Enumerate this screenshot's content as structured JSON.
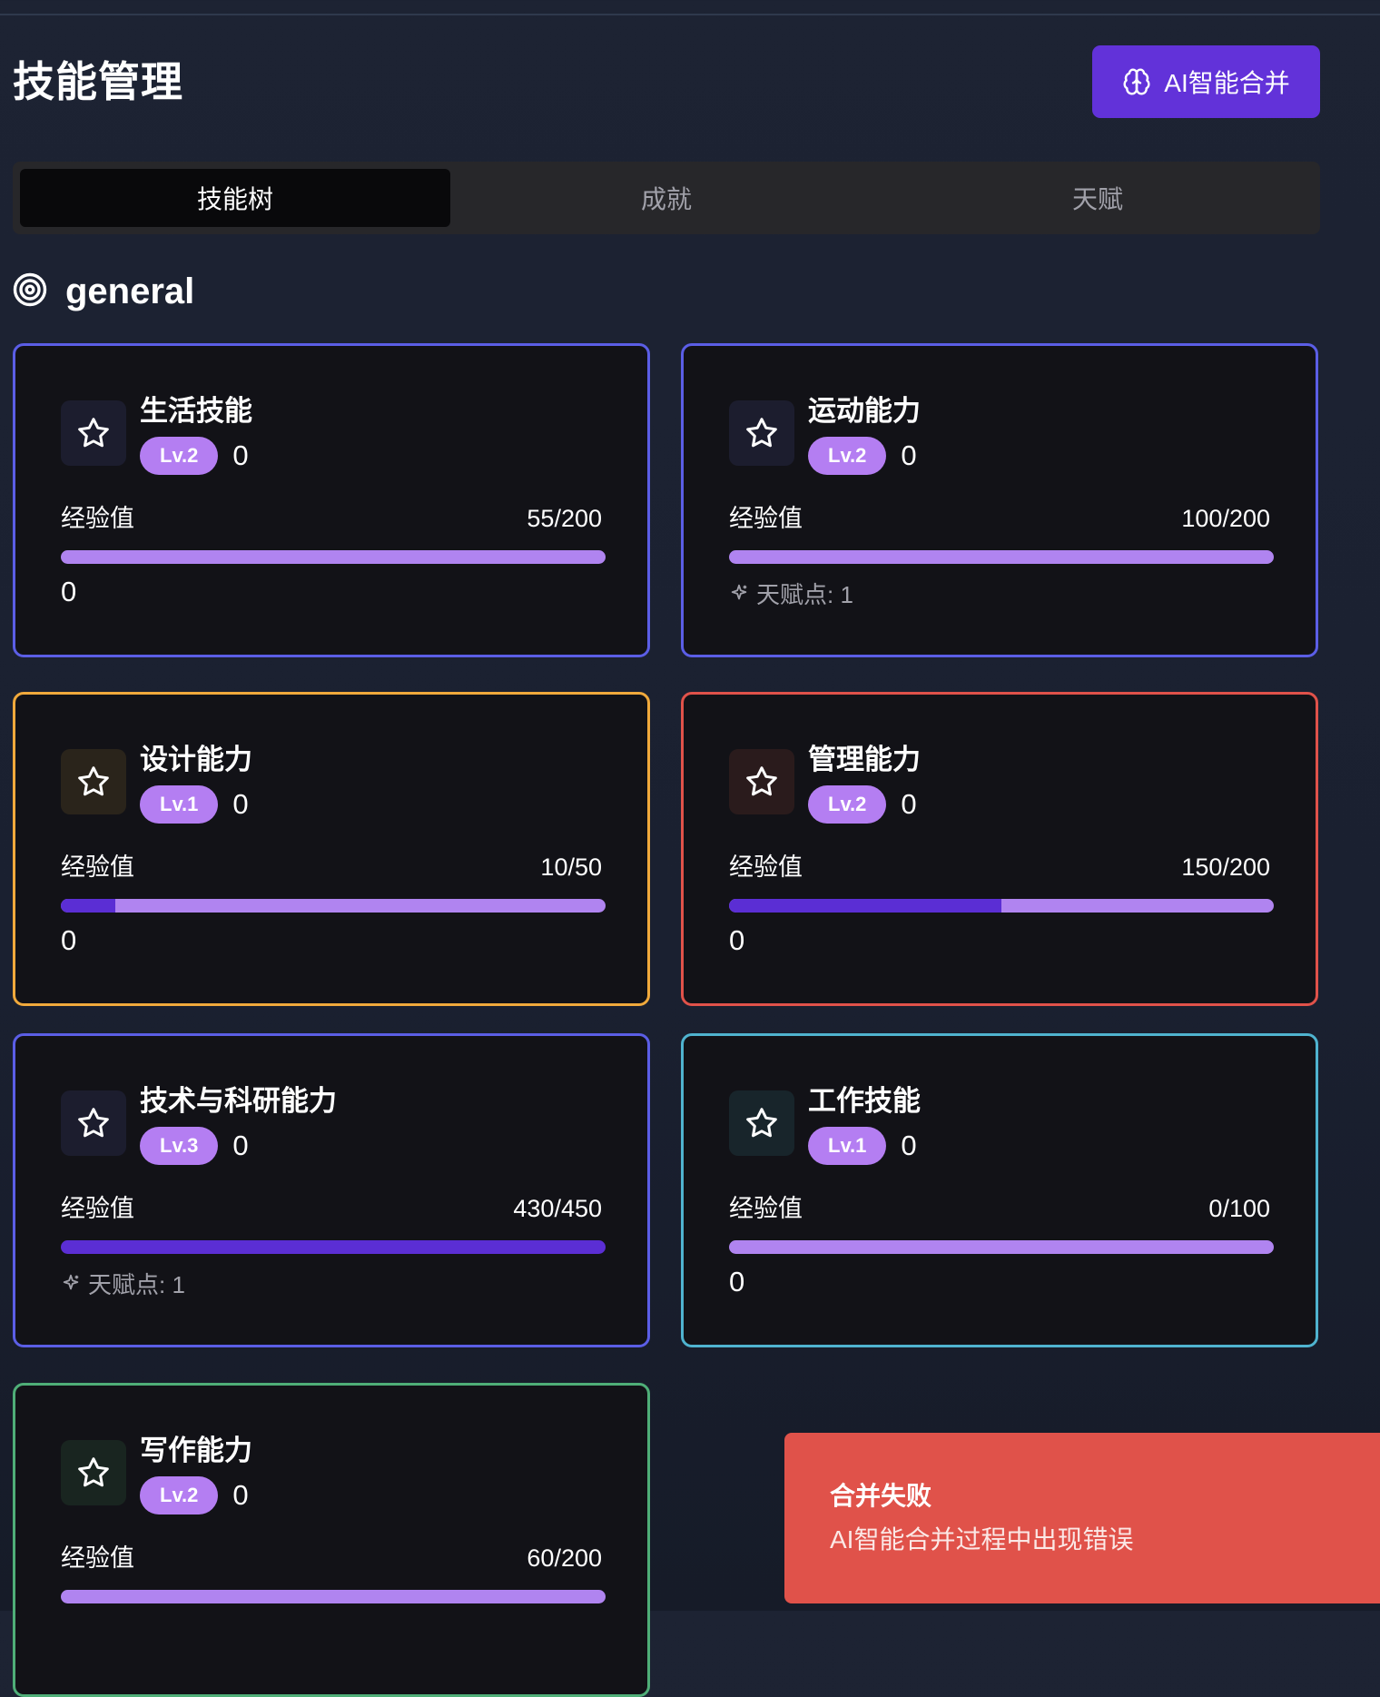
{
  "header": {
    "title": "技能管理",
    "ai_merge_label": "AI智能合并",
    "ai_merge_icon": "brain-icon"
  },
  "tabs": [
    {
      "label": "技能树",
      "active": true
    },
    {
      "label": "成就",
      "active": false
    },
    {
      "label": "天赋",
      "active": false
    }
  ],
  "section": {
    "title": "general",
    "icon": "target-icon"
  },
  "xp_label": "经验值",
  "skills": [
    {
      "name": "生活技能",
      "level": "Lv.2",
      "extra": "0",
      "xp": "55/200",
      "progress": 0.0,
      "footer": "0",
      "talent": null,
      "border_color": "#5b5ee6",
      "icon_bg": "#1c1d2e"
    },
    {
      "name": "运动能力",
      "level": "Lv.2",
      "extra": "0",
      "xp": "100/200",
      "progress": 0.0,
      "footer": null,
      "talent": "天赋点: 1",
      "border_color": "#5b5ee6",
      "icon_bg": "#1c1d2e"
    },
    {
      "name": "设计能力",
      "level": "Lv.1",
      "extra": "0",
      "xp": "10/50",
      "progress": 0.1,
      "footer": "0",
      "talent": null,
      "border_color": "#f0a93c",
      "icon_bg": "#2a241b"
    },
    {
      "name": "管理能力",
      "level": "Lv.2",
      "extra": "0",
      "xp": "150/200",
      "progress": 0.5,
      "footer": "0",
      "talent": null,
      "border_color": "#e0524a",
      "icon_bg": "#2a1b1c"
    },
    {
      "name": "技术与科研能力",
      "level": "Lv.3",
      "extra": "0",
      "xp": "430/450",
      "progress": 1.0,
      "footer": null,
      "talent": "天赋点: 1",
      "border_color": "#5b5ee6",
      "icon_bg": "#1c1d2e"
    },
    {
      "name": "工作技能",
      "level": "Lv.1",
      "extra": "0",
      "xp": "0/100",
      "progress": 0.0,
      "footer": "0",
      "talent": null,
      "border_color": "#4fb3cf",
      "icon_bg": "#18252b"
    },
    {
      "name": "写作能力",
      "level": "Lv.2",
      "extra": "0",
      "xp": "60/200",
      "progress": 0.0,
      "footer": null,
      "talent": null,
      "border_color": "#4fae78",
      "icon_bg": "#192520"
    }
  ],
  "toast": {
    "title": "合并失败",
    "message": "AI智能合并过程中出现错误"
  },
  "colors": {
    "accent": "#6232d9",
    "badge": "#b47ef2",
    "bar_track": "#b084f0",
    "bar_fill": "#5b2ed4",
    "toast_bg": "#e0524a"
  }
}
